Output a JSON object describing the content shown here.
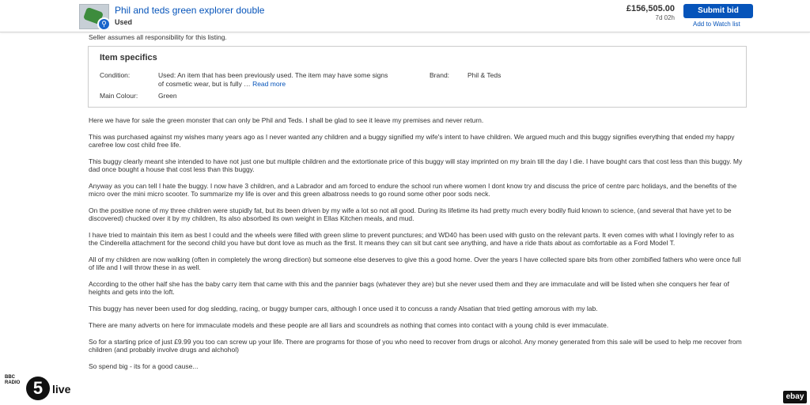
{
  "header": {
    "title": "Phil and teds green explorer double",
    "condition": "Used",
    "price": "£156,505.00",
    "time_left": "7d 02h",
    "bid_label": "Submit bid",
    "watch_label": "Add to Watch list"
  },
  "seller_note": "Seller assumes all responsibility for this listing.",
  "item_specifics": {
    "title": "Item specifics",
    "condition_label": "Condition:",
    "condition_value": "Used: An item that has been previously used. The item may have some signs",
    "condition_value_2": "of cosmetic wear, but is fully …",
    "read_more": "Read more",
    "brand_label": "Brand:",
    "brand_value": "Phil & Teds",
    "colour_label": "Main Colour:",
    "colour_value": "Green"
  },
  "description": [
    "Here we have for sale the green monster that can only be Phil and Teds. I shall be glad to see it leave my premises and never return.",
    "This was purchased against my wishes many years ago as I never wanted any children and a buggy signified my wife's intent to have children. We argued much and this buggy signifies everything that ended my happy carefree low cost child free life.",
    "This buggy clearly meant she intended to have not just one but multiple children and the extortionate price of this buggy will stay imprinted on my brain till the day I die. I have bought cars that cost less than this buggy. My dad once bought a house that cost less than this buggy.",
    "Anyway as you can tell I hate the buggy. I now have 3 children, and a Labrador and am forced to endure the school run where women I dont know try  and discuss the price of centre parc holidays, and the benefits of the micro over the mini micro scooter. To summarize my life is over and this green albatross needs to go round some other poor sods neck.",
    "On the positive none of my three children were stupidly fat, but its been driven by my wife a lot so not all good. During its lifetime its had pretty much every bodily fluid known to science, (and several that have yet to be discovered) chucked over it by my children, Its also absorbed its own weight in Ellas Kitchen meals, and mud.",
    "I have tried to maintain this item as best I could and the wheels were filled with green slime to prevent punctures; and WD40 has been used with gusto on the relevant parts. It even comes with what I lovingly refer to as the Cinderella attachment for the second child you have but dont love as much as the first. It means they can sit but cant see anything, and have a ride thats about as comfortable as a Ford Model T.",
    "All of my children are now walking (often in completely the wrong direction) but someone else deserves to give this a good home. Over the years I have collected spare bits from other zombified fathers who were once full of life and I will throw these in as well.",
    "According to the other half she has the baby carry item that came with this and the pannier bags (whatever they are) but she never used them and they are immaculate and will be listed when she conquers her fear of heights and gets into the loft.",
    "This buggy has never been used for dog sledding, racing, or buggy bumper cars, although I once used it to concuss a randy Alsatian that tried getting amorous with my lab.",
    "There are many adverts on here for immaculate models and these people are all liars and scoundrels as nothing that comes into contact with a young child is ever immaculate.",
    "So for a starting price of just £9.99 you too can screw up your life. There are programs for those of you who need to recover from drugs or alcohol. Any money generated from this sale will be used to help me recover from children (and probably involve drugs and alchohol)",
    "So spend big - its for a good cause..."
  ],
  "overlay": {
    "bbc_line1": "BBC",
    "bbc_line2": "RADIO",
    "five": "5",
    "live": "live",
    "ebay": "ebay"
  },
  "colors": {
    "link": "#0654ba",
    "bid_button": "#0654ba"
  }
}
